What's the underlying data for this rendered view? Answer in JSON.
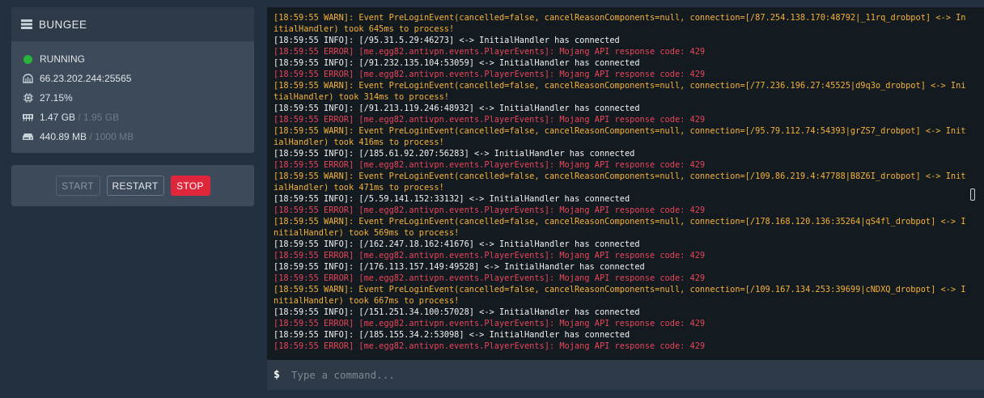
{
  "server": {
    "name": "BUNGEE",
    "status": "RUNNING",
    "address": "66.23.202.244:25565",
    "cpu": "27.15%",
    "memory_used": "1.47 GB",
    "memory_limit": "/ 1.95 GB",
    "disk_used": "440.89 MB",
    "disk_limit": "/ 1000 MB"
  },
  "controls": {
    "start_label": "START",
    "restart_label": "RESTART",
    "stop_label": "STOP"
  },
  "console": {
    "lines": [
      {
        "level": "warn",
        "text": "[18:59:55 WARN]: Event PreLoginEvent(cancelled=false, cancelReasonComponents=null, connection=[/87.254.138.170:48792|_11rq_drobpot] <-> InitialHandler) took 645ms to process!"
      },
      {
        "level": "info",
        "text": "[18:59:55 INFO]: [/95.31.5.29:46273] <-> InitialHandler has connected"
      },
      {
        "level": "error",
        "text": "[18:59:55 ERROR] [me.egg82.antivpn.events.PlayerEvents]: Mojang API response code: 429"
      },
      {
        "level": "info",
        "text": "[18:59:55 INFO]: [/91.232.135.104:53059] <-> InitialHandler has connected"
      },
      {
        "level": "error",
        "text": "[18:59:55 ERROR] [me.egg82.antivpn.events.PlayerEvents]: Mojang API response code: 429"
      },
      {
        "level": "warn",
        "text": "[18:59:55 WARN]: Event PreLoginEvent(cancelled=false, cancelReasonComponents=null, connection=[/77.236.196.27:45525|d9q3o_drobpot] <-> InitialHandler) took 314ms to process!"
      },
      {
        "level": "info",
        "text": "[18:59:55 INFO]: [/91.213.119.246:48932] <-> InitialHandler has connected"
      },
      {
        "level": "error",
        "text": "[18:59:55 ERROR] [me.egg82.antivpn.events.PlayerEvents]: Mojang API response code: 429"
      },
      {
        "level": "warn",
        "text": "[18:59:55 WARN]: Event PreLoginEvent(cancelled=false, cancelReasonComponents=null, connection=[/95.79.112.74:54393|grZS7_drobpot] <-> InitialHandler) took 416ms to process!"
      },
      {
        "level": "info",
        "text": "[18:59:55 INFO]: [/185.61.92.207:56283] <-> InitialHandler has connected"
      },
      {
        "level": "error",
        "text": "[18:59:55 ERROR] [me.egg82.antivpn.events.PlayerEvents]: Mojang API response code: 429"
      },
      {
        "level": "warn",
        "text": "[18:59:55 WARN]: Event PreLoginEvent(cancelled=false, cancelReasonComponents=null, connection=[/109.86.219.4:47788|B8Z6I_drobpot] <-> InitialHandler) took 471ms to process!"
      },
      {
        "level": "info",
        "text": "[18:59:55 INFO]: [/5.59.141.152:33132] <-> InitialHandler has connected"
      },
      {
        "level": "error",
        "text": "[18:59:55 ERROR] [me.egg82.antivpn.events.PlayerEvents]: Mojang API response code: 429"
      },
      {
        "level": "warn",
        "text": "[18:59:55 WARN]: Event PreLoginEvent(cancelled=false, cancelReasonComponents=null, connection=[/178.168.120.136:35264|qS4fl_drobpot] <-> InitialHandler) took 569ms to process!"
      },
      {
        "level": "info",
        "text": "[18:59:55 INFO]: [/162.247.18.162:41676] <-> InitialHandler has connected"
      },
      {
        "level": "error",
        "text": "[18:59:55 ERROR] [me.egg82.antivpn.events.PlayerEvents]: Mojang API response code: 429"
      },
      {
        "level": "info",
        "text": "[18:59:55 INFO]: [/176.113.157.149:49528] <-> InitialHandler has connected"
      },
      {
        "level": "error",
        "text": "[18:59:55 ERROR] [me.egg82.antivpn.events.PlayerEvents]: Mojang API response code: 429"
      },
      {
        "level": "warn",
        "text": "[18:59:55 WARN]: Event PreLoginEvent(cancelled=false, cancelReasonComponents=null, connection=[/109.167.134.253:39699|cNDXQ_drobpot] <-> InitialHandler) took 667ms to process!"
      },
      {
        "level": "info",
        "text": "[18:59:55 INFO]: [/151.251.34.100:57028] <-> InitialHandler has connected"
      },
      {
        "level": "error",
        "text": "[18:59:55 ERROR] [me.egg82.antivpn.events.PlayerEvents]: Mojang API response code: 429"
      },
      {
        "level": "info",
        "text": "[18:59:55 INFO]: [/185.155.34.2:53098] <-> InitialHandler has connected"
      },
      {
        "level": "error",
        "text": "[18:59:55 ERROR] [me.egg82.antivpn.events.PlayerEvents]: Mojang API response code: 429"
      }
    ]
  },
  "command": {
    "prompt": "$",
    "placeholder": "Type a command..."
  },
  "colors": {
    "running": "#27b43a",
    "stop": "#e0263a",
    "warn": "#f5b23a",
    "info": "#f2f2f2",
    "error": "#e8445a"
  }
}
